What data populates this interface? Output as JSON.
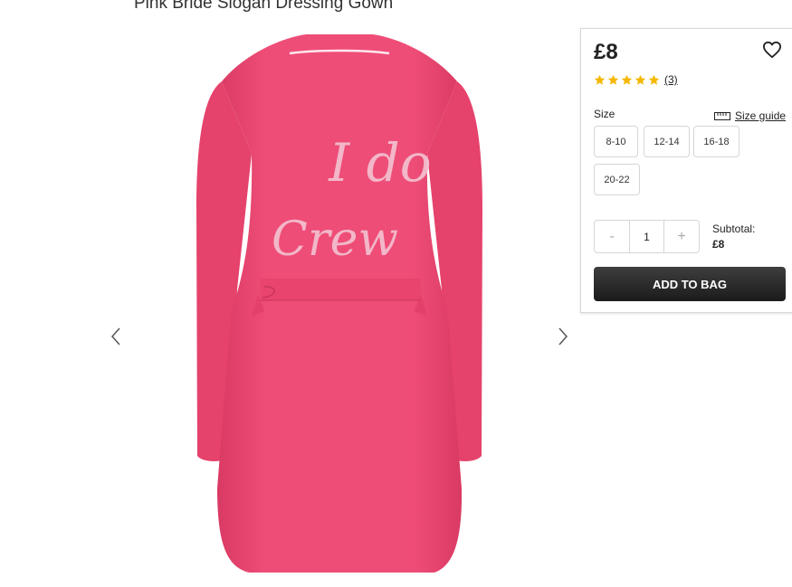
{
  "product": {
    "title": "Pink Bride Slogan Dressing Gown"
  },
  "gallery": {
    "prev_icon": "chevron-left-icon",
    "next_icon": "chevron-right-icon",
    "image_text_line1": "I do",
    "image_text_line2": "Crew"
  },
  "panel": {
    "price": "£8",
    "wishlist_icon": "heart-icon",
    "rating": {
      "stars": 5,
      "max": 5,
      "review_count": "(3)",
      "star_color": "#f5b800"
    },
    "size": {
      "label": "Size",
      "guide_label": "Size guide",
      "guide_icon": "ruler-icon",
      "options": [
        "8-10",
        "12-14",
        "16-18",
        "20-22"
      ]
    },
    "quantity": {
      "minus": "-",
      "value": "1",
      "plus": "+"
    },
    "subtotal": {
      "label": "Subtotal:",
      "value": "£8"
    },
    "add_to_bag": "ADD TO BAG"
  },
  "colors": {
    "product": "#ec4a74",
    "button": "#2a2a2a"
  }
}
